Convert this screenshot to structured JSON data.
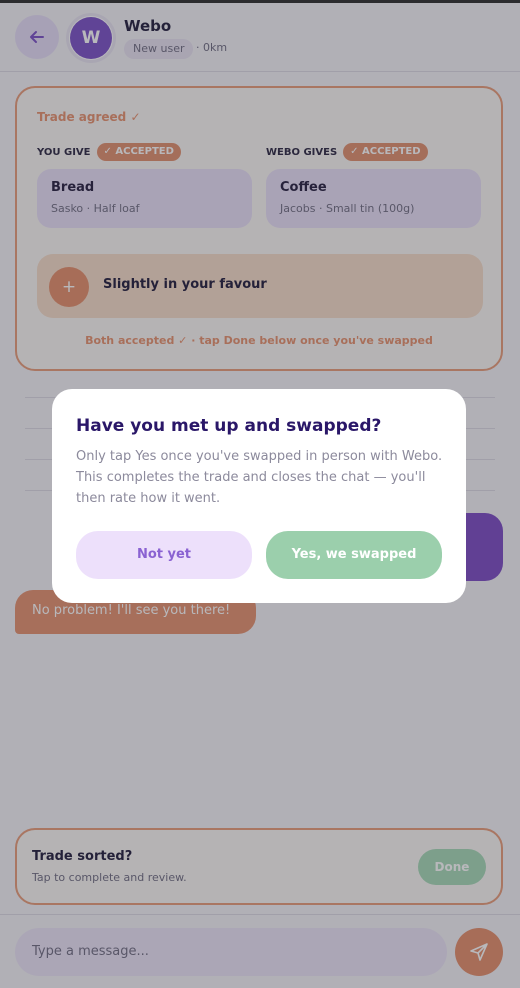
{
  "header": {
    "avatar_initial": "W",
    "name": "Webo",
    "badge": "New user",
    "distance": "· 0km"
  },
  "trade": {
    "status": "Trade agreed ✓",
    "you_give": {
      "label": "YOU GIVE",
      "badge": "✓ ACCEPTED",
      "item_name": "Bread",
      "item_detail": "Sasko · Half loaf"
    },
    "they_give": {
      "label": "WEBO GIVES",
      "badge": "✓ ACCEPTED",
      "item_name": "Coffee",
      "item_detail": "Jacobs · Small tin (100g)"
    },
    "fairness_icon": "+",
    "fairness_text": "Slightly in your favour",
    "note": "Both accepted ✓ · tap Done below once you've swapped"
  },
  "chat": {
    "messages": [
      {
        "from": "them",
        "text": "No problem! I'll see you there!"
      }
    ]
  },
  "sorted": {
    "title": "Trade sorted?",
    "subtitle": "Tap to complete and review.",
    "done_label": "Done"
  },
  "composer": {
    "placeholder": "Type a message..."
  },
  "modal": {
    "title": "Have you met up and swapped?",
    "body": "Only tap Yes once you've swapped in person with Webo. This completes the trade and closes the chat — you'll then rate how it went.",
    "no_label": "Not yet",
    "yes_label": "Yes, we swapped"
  },
  "icons": {
    "back": "arrow-left-icon",
    "send": "send-icon"
  },
  "colors": {
    "primary": "#7a4fc7",
    "accent": "#e58d69",
    "success": "#9bcfac",
    "text_dark": "#2a1768"
  }
}
